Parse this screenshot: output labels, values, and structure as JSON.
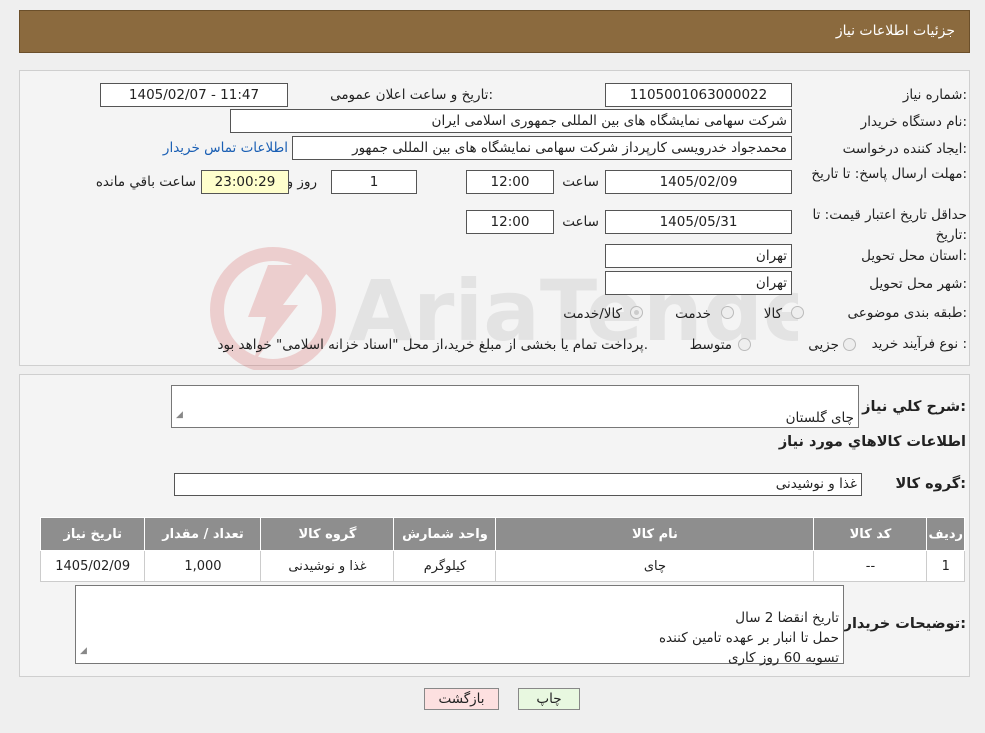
{
  "header": {
    "title": "جزئیات اطلاعات نیاز"
  },
  "fields": {
    "need_number_label": "شماره نیاز:",
    "need_number": "1105001063000022",
    "announce_label": "تاریخ و ساعت اعلان عمومی:",
    "announce_value": "1405/02/07 - 11:47",
    "buyer_org_label": "نام دستگاه خریدار:",
    "buyer_org": "شرکت سهامی نمایشگاه های بین المللی جمهوری اسلامی ایران",
    "creator_label": "ایجاد کننده درخواست:",
    "creator": "محمدجواد خدرویسی کارپرداز شرکت سهامی نمایشگاه های بین المللی جمهور",
    "contact_link": "اطلاعات تماس خریدار",
    "reply_deadline_label": "مهلت ارسال پاسخ: تا تاریخ:",
    "reply_date": "1405/02/09",
    "time_label": "ساعت",
    "reply_time": "12:00",
    "days_value": "1",
    "days_label": "روز و",
    "remaining_time": "23:00:29",
    "remaining_label": "ساعت باقي مانده",
    "min_validity_label": "حداقل تاریخ اعتبار قیمت: تا تاریخ:",
    "validity_date": "1405/05/31",
    "validity_time": "12:00",
    "province_label": "استان محل تحویل:",
    "province": "تهران",
    "city_label": "شهر محل تحویل:",
    "city": "تهران",
    "category_label": "طبقه بندی موضوعی:",
    "category_options": [
      "کالا",
      "خدمت",
      "کالا/خدمت"
    ],
    "process_label": "نوع فرآیند خرید :",
    "process_options": [
      "جزیی",
      "متوسط"
    ],
    "process_note": "پرداخت تمام یا بخشی از مبلغ خرید،از محل \"اسناد خزانه اسلامی\" خواهد بود."
  },
  "summary": {
    "desc_label": "شرح کلي نياز:",
    "desc_value": "چای گلستان",
    "items_heading": "اطلاعات کالاهاي مورد نياز",
    "group_label": "گروه کالا:",
    "group_value": "غذا و نوشیدنی"
  },
  "table": {
    "headers": [
      "رديف",
      "کد کالا",
      "نام کالا",
      "واحد شمارش",
      "گروه کالا",
      "تعداد / مقدار",
      "تاریخ نیاز"
    ],
    "rows": [
      [
        "1",
        "--",
        "چای",
        "کیلوگرم",
        "غذا و نوشیدنی",
        "1,000",
        "1405/02/09"
      ]
    ]
  },
  "notes": {
    "label": "توضیحات خریدار:",
    "text": "تاریخ انقضا 2 سال\nحمل تا انبار بر عهده تامین کننده\nتسویه 60 روز کاری"
  },
  "buttons": {
    "print": "چاپ",
    "back": "بازگشت"
  },
  "watermark": {
    "text": "AriaTender.neT"
  },
  "colors": {
    "header_bg": "#8b6a3e",
    "table_header_bg": "#8e8e8e",
    "print_btn": "#e8f8e0",
    "back_btn": "#fde0e0"
  }
}
